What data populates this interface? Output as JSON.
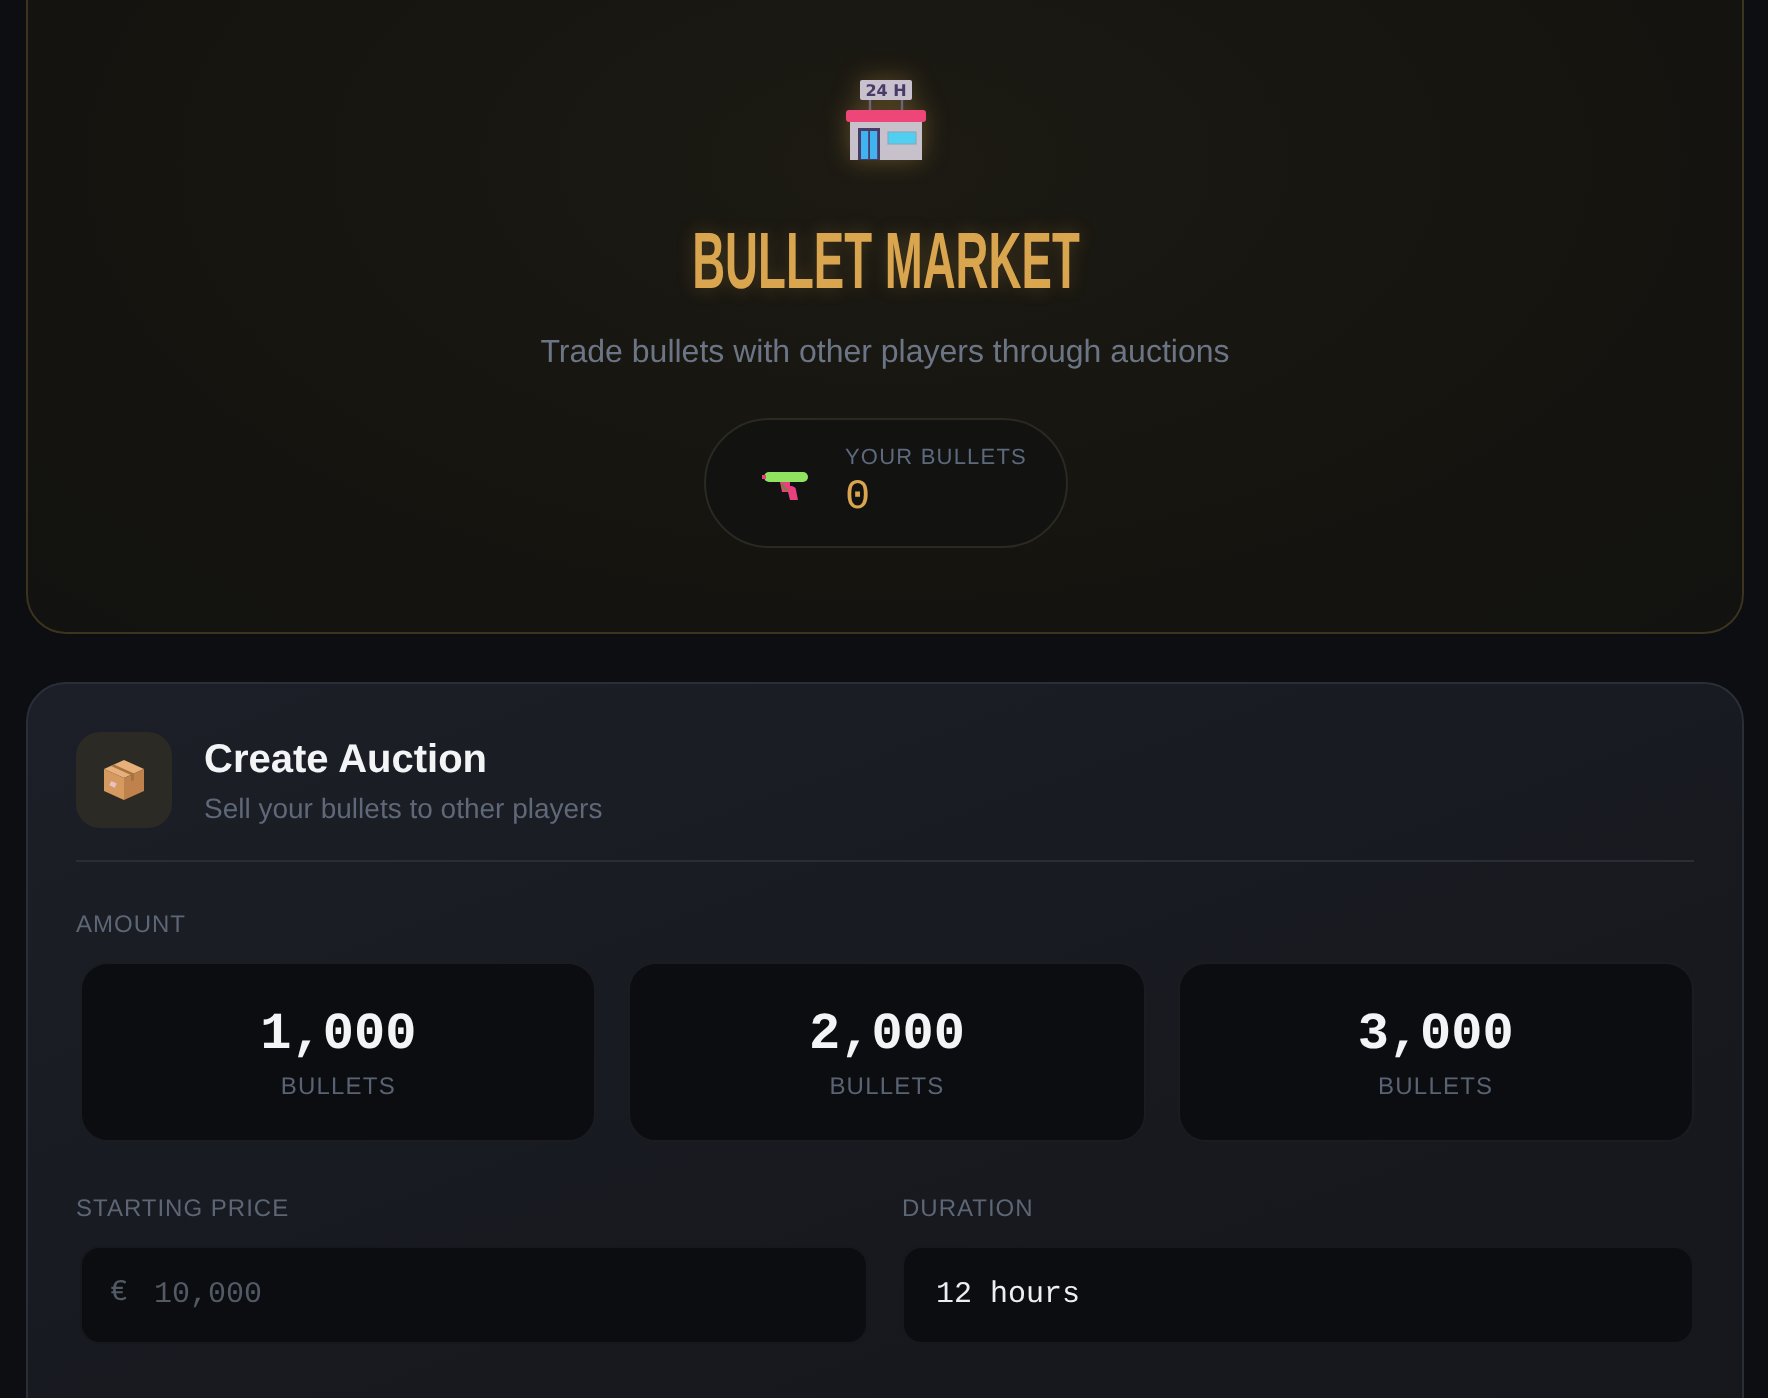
{
  "hero": {
    "icon_sign": "24 H",
    "title": "BULLET MARKET",
    "subtitle": "Trade bullets with other players through auctions",
    "balance": {
      "label": "YOUR BULLETS",
      "value": "0"
    }
  },
  "create_auction": {
    "title": "Create Auction",
    "subtitle": "Sell your bullets to other players",
    "amount": {
      "label": "AMOUNT",
      "options": [
        {
          "value": "1,000",
          "unit": "BULLETS",
          "selected": false
        },
        {
          "value": "2,000",
          "unit": "BULLETS",
          "selected": false
        },
        {
          "value": "3,000",
          "unit": "BULLETS",
          "selected": false
        }
      ]
    },
    "starting_price": {
      "label": "STARTING PRICE",
      "prefix": "€",
      "placeholder": "10,000"
    },
    "duration": {
      "label": "DURATION",
      "value": "12 hours"
    }
  }
}
